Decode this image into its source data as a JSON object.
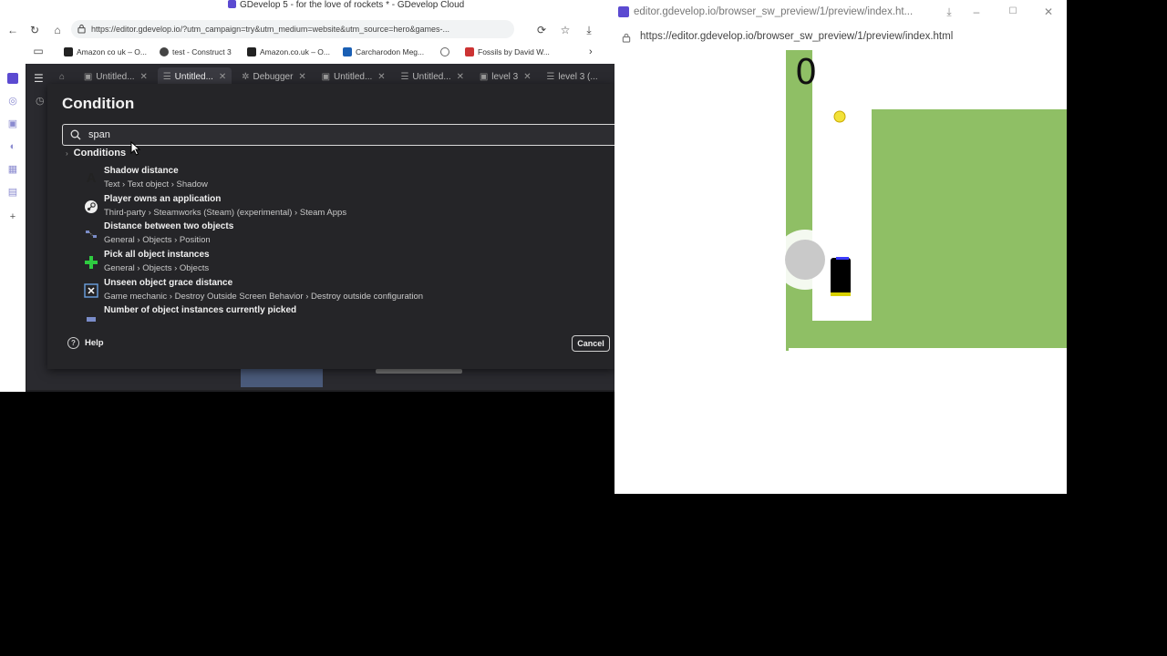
{
  "left_browser": {
    "title": "GDevelop 5 - for the love of rockets * - GDevelop Cloud",
    "url": "https://editor.gdevelop.io/?utm_campaign=try&utm_medium=website&utm_source=hero&games-...",
    "bookmarks": [
      {
        "label": "Amazon co uk – O...",
        "icon": "amazon-icon"
      },
      {
        "label": "test - Construct 3",
        "icon": "construct-icon"
      },
      {
        "label": "Amazon.co.uk – O...",
        "icon": "amazon-icon"
      },
      {
        "label": "Carcharodon Meg...",
        "icon": "bookmark-icon"
      },
      {
        "label": "Fossils by David W...",
        "icon": "bookmark-icon"
      }
    ]
  },
  "gdevelop": {
    "tabs": [
      {
        "label": "Untitled...",
        "icon": "scene-icon"
      },
      {
        "label": "Untitled...",
        "icon": "events-icon",
        "active": true
      },
      {
        "label": "Debugger",
        "icon": "debugger-icon"
      },
      {
        "label": "Untitled...",
        "icon": "scene-icon"
      },
      {
        "label": "Untitled...",
        "icon": "events-icon"
      },
      {
        "label": "level 3",
        "icon": "scene-icon"
      },
      {
        "label": "level 3 (...",
        "icon": "events-icon"
      }
    ],
    "dialog": {
      "title": "Condition",
      "search_value": "span",
      "section_label": "Conditions",
      "results": [
        {
          "name": "Shadow distance",
          "path": "Text › Text object › Shadow",
          "icon": "text-a-icon"
        },
        {
          "name": "Player owns an application",
          "path": "Third-party › Steamworks (Steam) (experimental) › Steam Apps",
          "icon": "steam-icon"
        },
        {
          "name": "Distance between two objects",
          "path": "General › Objects › Position",
          "icon": "distance-icon"
        },
        {
          "name": "Pick all object instances",
          "path": "General › Objects › Objects",
          "icon": "plus-icon"
        },
        {
          "name": "Unseen object grace distance",
          "path": "Game mechanic › Destroy Outside Screen Behavior › Destroy outside configuration",
          "icon": "destroy-outside-icon"
        },
        {
          "name": "Number of object instances currently picked",
          "path": "",
          "icon": "instances-icon"
        }
      ],
      "help_label": "Help",
      "cancel_label": "Cancel"
    }
  },
  "preview_window": {
    "title": "editor.gdevelop.io/browser_sw_preview/1/preview/index.ht...",
    "url": "https://editor.gdevelop.io/browser_sw_preview/1/preview/index.html",
    "score": "0"
  },
  "colors": {
    "dialog_bg": "#252528",
    "game_green": "#8fbf65",
    "brand_purple": "#5b4ad1"
  }
}
